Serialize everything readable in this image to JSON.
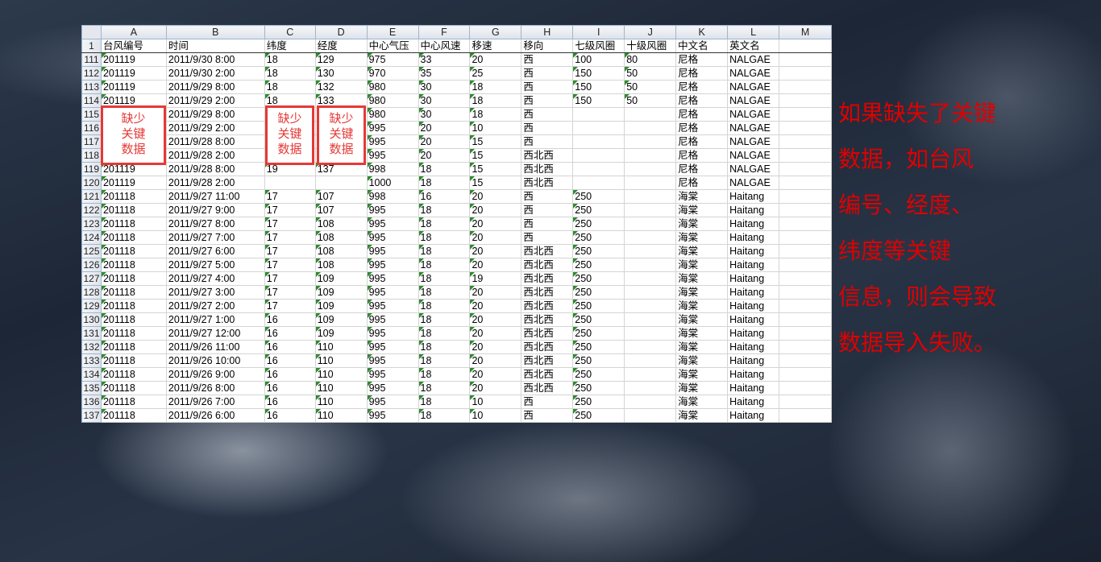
{
  "spreadsheet": {
    "column_letters": [
      "A",
      "B",
      "C",
      "D",
      "E",
      "F",
      "G",
      "H",
      "I",
      "J",
      "K",
      "L",
      "M"
    ],
    "headers": [
      "台风编号",
      "时间",
      "纬度",
      "经度",
      "中心气压",
      "中心风速",
      "移速",
      "移向",
      "七级风圈",
      "十级风圈",
      "中文名",
      "英文名",
      ""
    ],
    "header_row_number": "1",
    "rows": [
      {
        "n": "111",
        "cells": [
          "201119",
          "2011/9/30 8:00",
          "18",
          "129",
          "975",
          "33",
          "20",
          "西",
          "100",
          "80",
          "尼格",
          "NALGAE",
          ""
        ]
      },
      {
        "n": "112",
        "cells": [
          "201119",
          "2011/9/30 2:00",
          "18",
          "130",
          "970",
          "35",
          "25",
          "西",
          "150",
          "50",
          "尼格",
          "NALGAE",
          ""
        ]
      },
      {
        "n": "113",
        "cells": [
          "201119",
          "2011/9/29 8:00",
          "18",
          "132",
          "980",
          "30",
          "18",
          "西",
          "150",
          "50",
          "尼格",
          "NALGAE",
          ""
        ]
      },
      {
        "n": "114",
        "cells": [
          "201119",
          "2011/9/29 2:00",
          "18",
          "133",
          "980",
          "30",
          "18",
          "西",
          "150",
          "50",
          "尼格",
          "NALGAE",
          ""
        ]
      },
      {
        "n": "115",
        "cells": [
          "",
          "2011/9/29 8:00",
          "",
          "",
          "980",
          "30",
          "18",
          "西",
          "",
          "",
          "尼格",
          "NALGAE",
          ""
        ]
      },
      {
        "n": "116",
        "cells": [
          "",
          "2011/9/29 2:00",
          "",
          "",
          "995",
          "20",
          "10",
          "西",
          "",
          "",
          "尼格",
          "NALGAE",
          ""
        ]
      },
      {
        "n": "117",
        "cells": [
          "",
          "2011/9/28 8:00",
          "",
          "",
          "995",
          "20",
          "15",
          "西",
          "",
          "",
          "尼格",
          "NALGAE",
          ""
        ]
      },
      {
        "n": "118",
        "cells": [
          "",
          "2011/9/28 2:00",
          "",
          "",
          "995",
          "20",
          "15",
          "西北西",
          "",
          "",
          "尼格",
          "NALGAE",
          ""
        ]
      },
      {
        "n": "119",
        "cells": [
          "201119",
          "2011/9/28 8:00",
          "19",
          "137",
          "998",
          "18",
          "15",
          "西北西",
          "",
          "",
          "尼格",
          "NALGAE",
          ""
        ]
      },
      {
        "n": "120",
        "cells": [
          "201119",
          "2011/9/28 2:00",
          "",
          "",
          "1000",
          "18",
          "15",
          "西北西",
          "",
          "",
          "尼格",
          "NALGAE",
          ""
        ]
      },
      {
        "n": "121",
        "cells": [
          "201118",
          "2011/9/27 11:00",
          "17",
          "107",
          "998",
          "16",
          "20",
          "西",
          "250",
          "",
          "海棠",
          "Haitang",
          ""
        ]
      },
      {
        "n": "122",
        "cells": [
          "201118",
          "2011/9/27 9:00",
          "17",
          "107",
          "995",
          "18",
          "20",
          "西",
          "250",
          "",
          "海棠",
          "Haitang",
          ""
        ]
      },
      {
        "n": "123",
        "cells": [
          "201118",
          "2011/9/27 8:00",
          "17",
          "108",
          "995",
          "18",
          "20",
          "西",
          "250",
          "",
          "海棠",
          "Haitang",
          ""
        ]
      },
      {
        "n": "124",
        "cells": [
          "201118",
          "2011/9/27 7:00",
          "17",
          "108",
          "995",
          "18",
          "20",
          "西",
          "250",
          "",
          "海棠",
          "Haitang",
          ""
        ]
      },
      {
        "n": "125",
        "cells": [
          "201118",
          "2011/9/27 6:00",
          "17",
          "108",
          "995",
          "18",
          "20",
          "西北西",
          "250",
          "",
          "海棠",
          "Haitang",
          ""
        ]
      },
      {
        "n": "126",
        "cells": [
          "201118",
          "2011/9/27 5:00",
          "17",
          "108",
          "995",
          "18",
          "20",
          "西北西",
          "250",
          "",
          "海棠",
          "Haitang",
          ""
        ]
      },
      {
        "n": "127",
        "cells": [
          "201118",
          "2011/9/27 4:00",
          "17",
          "109",
          "995",
          "18",
          "19",
          "西北西",
          "250",
          "",
          "海棠",
          "Haitang",
          ""
        ]
      },
      {
        "n": "128",
        "cells": [
          "201118",
          "2011/9/27 3:00",
          "17",
          "109",
          "995",
          "18",
          "20",
          "西北西",
          "250",
          "",
          "海棠",
          "Haitang",
          ""
        ]
      },
      {
        "n": "129",
        "cells": [
          "201118",
          "2011/9/27 2:00",
          "17",
          "109",
          "995",
          "18",
          "20",
          "西北西",
          "250",
          "",
          "海棠",
          "Haitang",
          ""
        ]
      },
      {
        "n": "130",
        "cells": [
          "201118",
          "2011/9/27 1:00",
          "16",
          "109",
          "995",
          "18",
          "20",
          "西北西",
          "250",
          "",
          "海棠",
          "Haitang",
          ""
        ]
      },
      {
        "n": "131",
        "cells": [
          "201118",
          "2011/9/27 12:00",
          "16",
          "109",
          "995",
          "18",
          "20",
          "西北西",
          "250",
          "",
          "海棠",
          "Haitang",
          ""
        ]
      },
      {
        "n": "132",
        "cells": [
          "201118",
          "2011/9/26 11:00",
          "16",
          "110",
          "995",
          "18",
          "20",
          "西北西",
          "250",
          "",
          "海棠",
          "Haitang",
          ""
        ]
      },
      {
        "n": "133",
        "cells": [
          "201118",
          "2011/9/26 10:00",
          "16",
          "110",
          "995",
          "18",
          "20",
          "西北西",
          "250",
          "",
          "海棠",
          "Haitang",
          ""
        ]
      },
      {
        "n": "134",
        "cells": [
          "201118",
          "2011/9/26 9:00",
          "16",
          "110",
          "995",
          "18",
          "20",
          "西北西",
          "250",
          "",
          "海棠",
          "Haitang",
          ""
        ]
      },
      {
        "n": "135",
        "cells": [
          "201118",
          "2011/9/26 8:00",
          "16",
          "110",
          "995",
          "18",
          "20",
          "西北西",
          "250",
          "",
          "海棠",
          "Haitang",
          ""
        ]
      },
      {
        "n": "136",
        "cells": [
          "201118",
          "2011/9/26 7:00",
          "16",
          "110",
          "995",
          "18",
          "10",
          "西",
          "250",
          "",
          "海棠",
          "Haitang",
          ""
        ]
      },
      {
        "n": "137",
        "cells": [
          "201118",
          "2011/9/26 6:00",
          "16",
          "110",
          "995",
          "18",
          "10",
          "西",
          "250",
          "",
          "海棠",
          "Haitang",
          ""
        ]
      }
    ]
  },
  "annotations": {
    "missing_box_lines": [
      "缺少",
      "关键",
      "数据"
    ]
  },
  "side_note": {
    "lines": [
      "如果缺失了关键",
      "数据，如台风",
      "编号、经度、",
      "纬度等关键",
      "信息，则会导致",
      "数据导入失败。"
    ]
  },
  "colors": {
    "annotation_red": "#e53935",
    "side_note_red": "#e00000",
    "triangle_green": "#2e8b2e"
  }
}
